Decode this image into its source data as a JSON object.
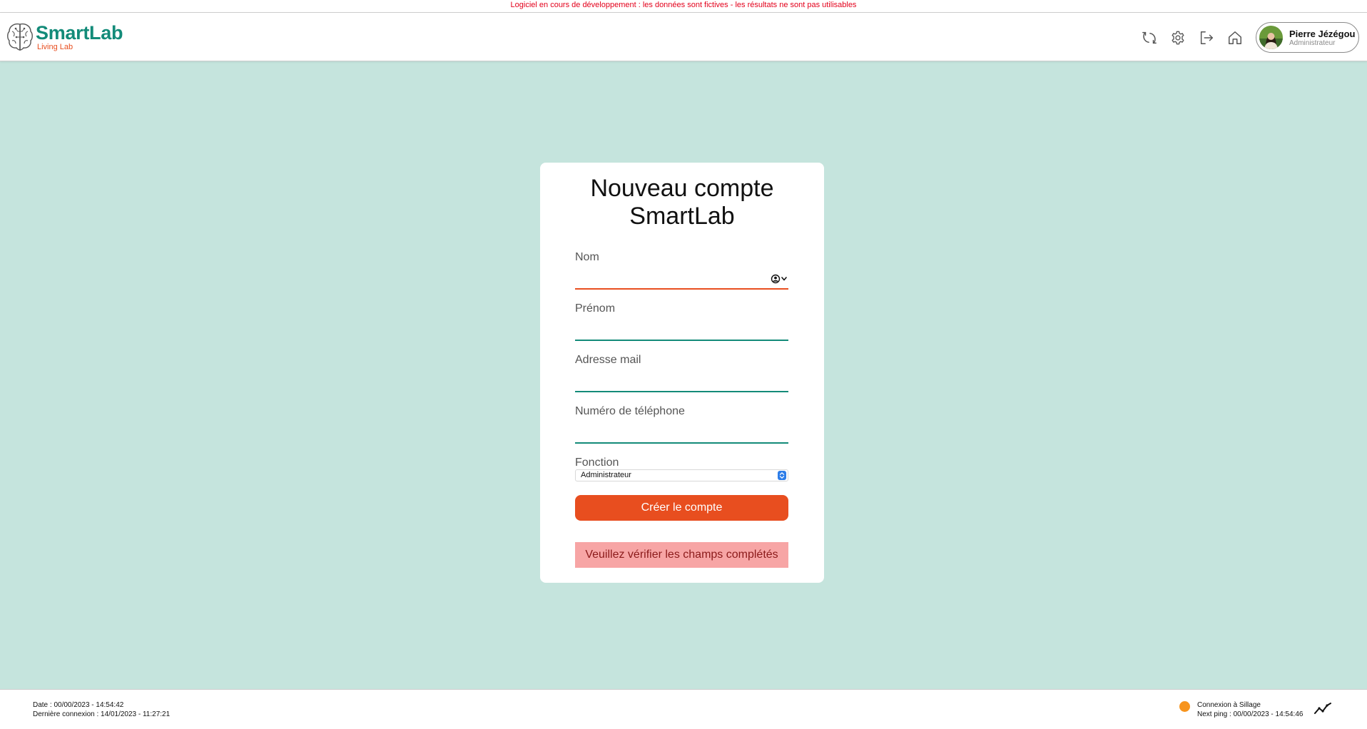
{
  "banner": {
    "text": "Logiciel en cours de développement : les données sont fictives - les résultats ne sont pas utilisables"
  },
  "header": {
    "logo_title": "SmartLab",
    "logo_subtitle": "Living Lab",
    "icons": [
      "sync-icon",
      "gear-icon",
      "logout-icon",
      "home-icon"
    ],
    "user": {
      "name": "Pierre Jézégou",
      "role": "Administrateur"
    }
  },
  "form": {
    "title_line1": "Nouveau compte",
    "title_line2": "SmartLab",
    "fields": [
      {
        "label": "Nom",
        "value": ""
      },
      {
        "label": "Prénom",
        "value": ""
      },
      {
        "label": "Adresse mail",
        "value": ""
      },
      {
        "label": "Numéro de téléphone",
        "value": ""
      }
    ],
    "fonction": {
      "label": "Fonction",
      "selected": "Administrateur"
    },
    "submit_label": "Créer le compte",
    "error_message": "Veuillez vérifier les champs complétés"
  },
  "footer": {
    "date": "Date : 00/00/2023 - 14:54:42",
    "last_login": "Dernière connexion : 14/01/2023 - 11:27:21",
    "connection_status": "Connexion à Sillage",
    "next_ping": "Next ping : 00/00/2023 - 14:54:46"
  },
  "colors": {
    "brand_teal": "#138b79",
    "accent_orange": "#e84e1f",
    "background": "#c5e4dd",
    "status_orange": "#f7941d",
    "error_bg": "#f7a5a5"
  }
}
